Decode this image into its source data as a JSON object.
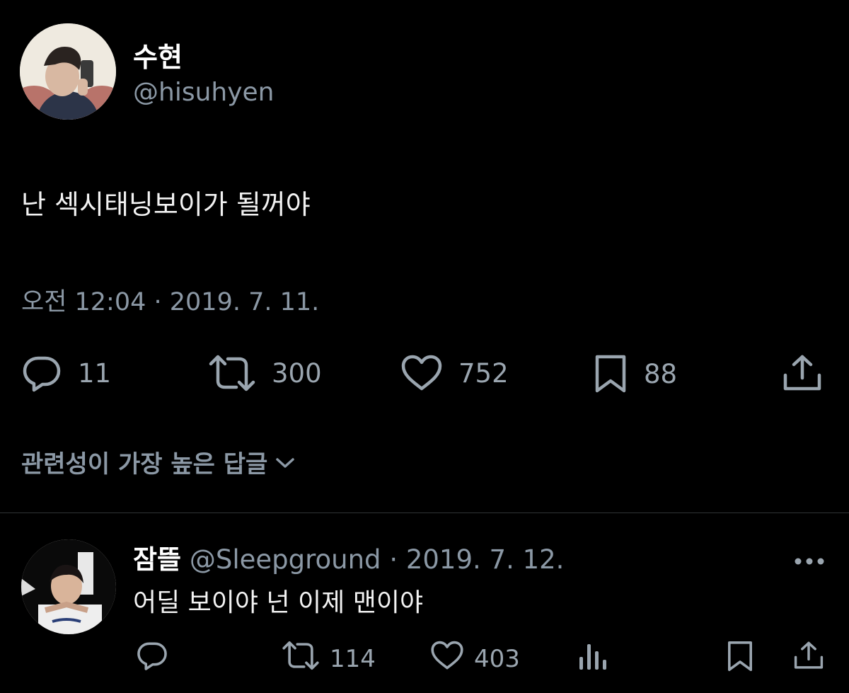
{
  "tweet": {
    "author_name": "수현",
    "author_handle": "@hisuhyen",
    "text": "난 섹시태닝보이가 될꺼야",
    "timestamp": "오전 12:04 · 2019. 7. 11.",
    "actions": {
      "reply_count": "11",
      "retweet_count": "300",
      "like_count": "752",
      "bookmark_count": "88"
    }
  },
  "replies_sort": {
    "label": "관련성이 가장 높은 답글"
  },
  "reply": {
    "author_name": "잠뜰",
    "author_handle": "@Sleepground",
    "date": "· 2019. 7. 12.",
    "text": "어딜 보이야 넌 이제 맨이야",
    "actions": {
      "retweet_count": "114",
      "like_count": "403"
    }
  },
  "icons": {
    "reply": "speech-bubble-icon",
    "retweet": "retweet-icon",
    "like": "heart-icon",
    "bookmark": "bookmark-icon",
    "share": "share-icon",
    "views": "bar-chart-icon",
    "more": "more-dots-icon",
    "sort": "chevron-down-icon"
  },
  "colors": {
    "background": "#000000",
    "text_primary": "#e7e9ea",
    "text_secondary": "#8b98a5"
  }
}
